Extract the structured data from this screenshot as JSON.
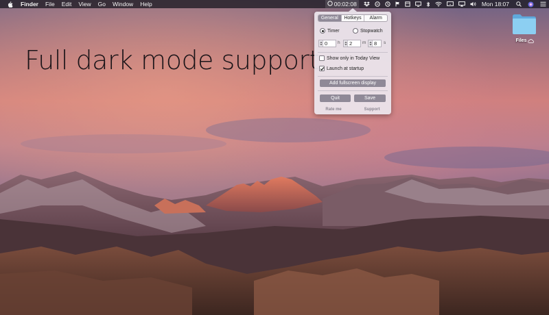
{
  "menubar": {
    "app_name": "Finder",
    "menus": [
      "File",
      "Edit",
      "View",
      "Go",
      "Window",
      "Help"
    ],
    "timer_readout": "00:02:08",
    "clock": "Mon 18:07",
    "status_icons": [
      "timer-icon",
      "dropbox-icon",
      "sync-icon",
      "clock-icon",
      "flag-icon",
      "box-icon",
      "screen-icon",
      "bluetooth-icon",
      "wifi-icon",
      "display-icon",
      "airplay-icon",
      "volume-icon",
      "search-icon",
      "siri-icon",
      "list-icon"
    ]
  },
  "popover": {
    "tabs": [
      {
        "label": "General",
        "selected": true
      },
      {
        "label": "Hotkeys",
        "selected": false
      },
      {
        "label": "Alarm",
        "selected": false
      }
    ],
    "mode_timer": "Timer",
    "mode_stopwatch": "Stopwatch",
    "mode_selected": "Timer",
    "hours": "0",
    "hours_unit": "h",
    "minutes": "2",
    "minutes_unit": "m",
    "seconds": "8",
    "seconds_unit": "s",
    "show_only_today": {
      "label": "Show only in Today View",
      "checked": false
    },
    "launch_startup": {
      "label": "Launch at startup",
      "checked": true
    },
    "fullscreen_button": "Add fullscreen display",
    "quit_button": "Quit",
    "save_button": "Save",
    "rate_link": "Rate me",
    "support_link": "Support"
  },
  "desktop": {
    "headline": "Full dark mode support",
    "files_label": "Files"
  },
  "colors": {
    "accent_button": "#8f8997",
    "menubar_bg": "#1c1a22",
    "folder_blue": "#7cc3ea"
  }
}
